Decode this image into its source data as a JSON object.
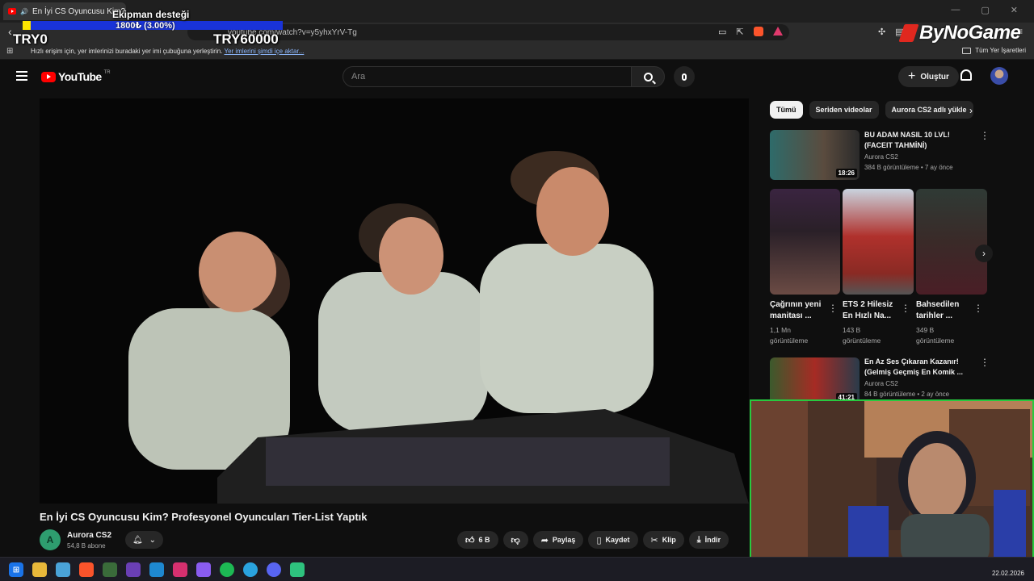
{
  "browser": {
    "tab_title": "En İyi CS Oyuncusu Kim? Profe",
    "tab_close": "✕",
    "url": "youtube.com/watch?v=y5yhxYrV-Tg",
    "window_min": "—",
    "window_max": "▢",
    "window_close": "✕"
  },
  "bookmarks": {
    "hint": "Hızlı erişim için, yer imlerinizi buradaki yer imi çubuğuna yerleştirin.",
    "import_link": "Yer imlerini şimdi içe aktar...",
    "all_bookmarks": "Tüm Yer İşaretleri"
  },
  "overlay": {
    "donation_title": "Ekipman desteği",
    "donation_amount": "1800₺ (3.00%)",
    "donation_progress": 0.03,
    "goal_start": "TRY0",
    "goal_end": "TRY60000",
    "brand": "ByNoGame"
  },
  "youtube": {
    "logo_text": "YouTube",
    "logo_country": "TR",
    "search_placeholder": "Ara",
    "create_label": "Oluştur",
    "video": {
      "title": "En İyi CS Oyuncusu Kim? Profesyonel Oyuncuları Tier-List Yaptık",
      "channel": "Aurora CS2",
      "subscribers": "54,8 B abone",
      "likes": "6 B",
      "share": "Paylaş",
      "save": "Kaydet",
      "clip": "Klip",
      "download": "İndir"
    },
    "chips": [
      "Tümü",
      "Seriden videolar",
      "Aurora CS2 adlı yükle"
    ],
    "recommendations": [
      {
        "title_l1": "BU ADAM NASIL 10 LVL!",
        "title_l2": "(FACEIT TAHMİNİ)",
        "channel": "Aurora CS2",
        "meta": "384 B görüntüleme • 7 ay önce",
        "duration": "18:26"
      },
      {
        "title_l1": "En Az Ses Çıkaran Kazanır!",
        "title_l2": "(Gelmiş Geçmiş En Komik ...",
        "channel": "Aurora CS2",
        "meta": "84 B görüntüleme • 2 ay önce",
        "duration": "41:21"
      }
    ],
    "shorts": [
      {
        "title_l1": "Çağrının yeni",
        "title_l2": "manitası ...",
        "views_l1": "1,1 Mn",
        "views_l2": "görüntüleme"
      },
      {
        "title_l1": "ETS 2 Hilesiz",
        "title_l2": "En Hızlı Na...",
        "views_l1": "143 B",
        "views_l2": "görüntüleme"
      },
      {
        "title_l1": "Bahsedilen",
        "title_l2": "tarihler ...",
        "views_l1": "349 B",
        "views_l2": "görüntüleme"
      }
    ]
  },
  "taskbar": {
    "date": "22.02.2026"
  }
}
